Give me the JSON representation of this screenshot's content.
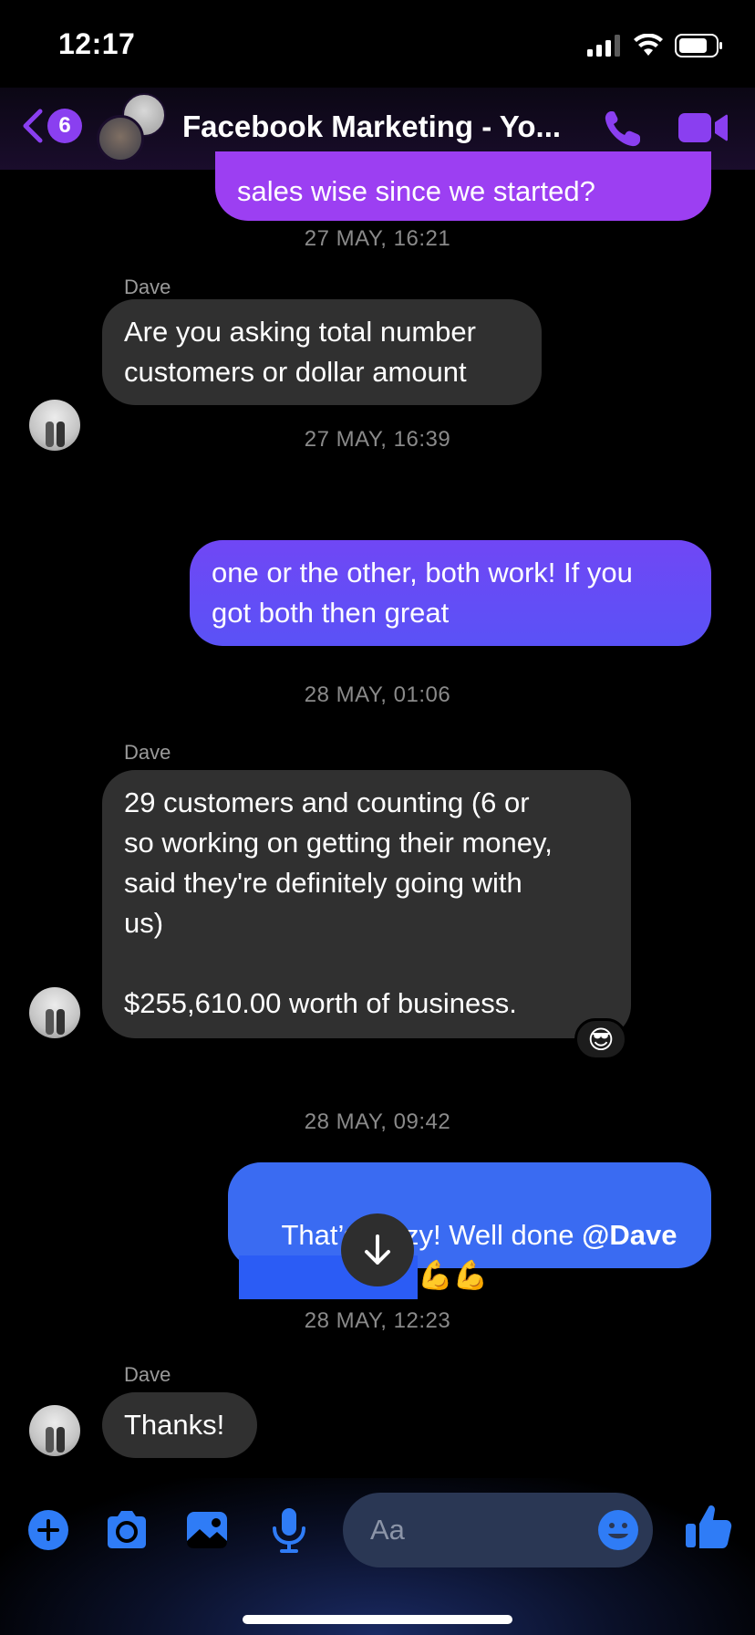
{
  "status_bar": {
    "time": "12:17"
  },
  "header": {
    "back_badge": "6",
    "title": "Facebook Marketing - Yo...",
    "call_icon": "phone-icon",
    "video_icon": "video-camera-icon"
  },
  "messages": [
    {
      "type": "outgoing",
      "text": "sales wise since we started?"
    },
    {
      "type": "timestamp",
      "text": "27 MAY, 16:21"
    },
    {
      "type": "incoming",
      "sender": "Dave",
      "text": "Are you asking total number\ncustomers or dollar amount"
    },
    {
      "type": "timestamp",
      "text": "27 MAY, 16:39"
    },
    {
      "type": "outgoing",
      "text": "one or the other, both work! If you\ngot both then great"
    },
    {
      "type": "timestamp",
      "text": "28 MAY, 01:06"
    },
    {
      "type": "incoming",
      "sender": "Dave",
      "text": "29 customers and counting (6 or\nso working on getting their money,\nsaid they're definitely going with\nus)\n\n$255,610.00 worth of business.",
      "reaction": "😎"
    },
    {
      "type": "timestamp",
      "text": "28 MAY, 09:42"
    },
    {
      "type": "outgoing",
      "text_before": "That’s crazy! Well done ",
      "mention": "@Dave",
      "emojis": "💪💪"
    },
    {
      "type": "timestamp",
      "text": "28 MAY, 12:23"
    },
    {
      "type": "incoming",
      "sender": "Dave",
      "text": "Thanks!"
    }
  ],
  "composer": {
    "placeholder": "Aa",
    "icons": [
      "plus-icon",
      "camera-icon",
      "photo-icon",
      "microphone-icon",
      "emoji-icon",
      "thumbs-up-icon"
    ]
  },
  "colors": {
    "accent_purple": "#8a3ff0",
    "bubble_purple_top": "#9c3ff2",
    "bubble_purple_mid": "#6a4ef6",
    "bubble_blue": "#3a6bf2",
    "incoming_bubble": "#303030",
    "composer_icon_blue": "#2f7cf6"
  }
}
